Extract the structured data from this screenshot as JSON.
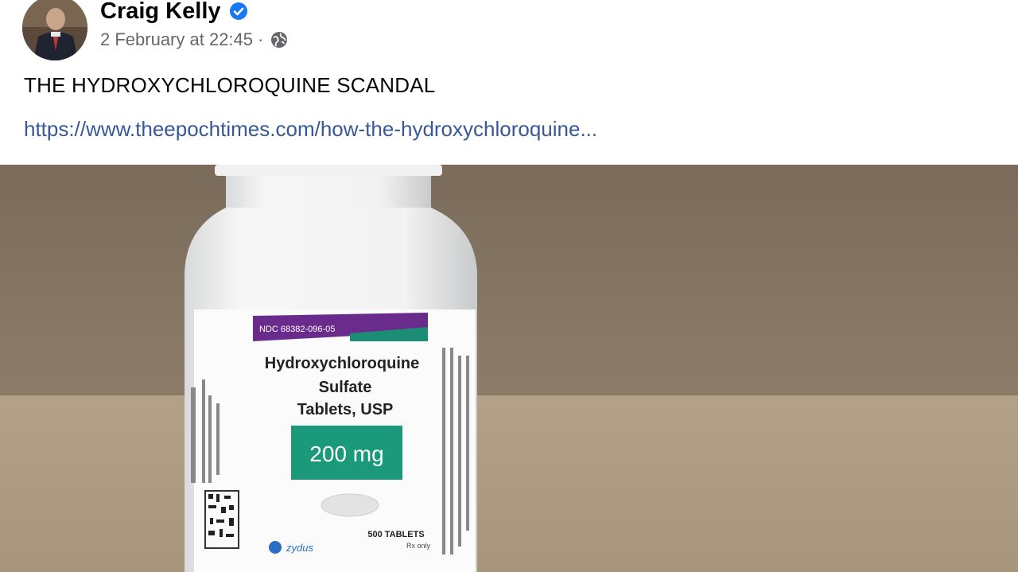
{
  "post": {
    "author": "Craig Kelly",
    "timestamp": "2 February at 22:45",
    "separator": "·",
    "text": "THE HYDROXYCHLOROQUINE SCANDAL",
    "link": "https://www.theepochtimes.com/how-the-hydroxychloroquine..."
  },
  "photo": {
    "label_ndc": "NDC 68382-096-05",
    "label_drug": "Hydroxychloroquine",
    "label_salt": "Sulfate",
    "label_form": "Tablets, USP",
    "label_dose": "200 mg",
    "label_count": "500 TABLETS",
    "label_rx": "Rx only",
    "label_brand": "zydus"
  },
  "colors": {
    "link": "#385898",
    "verified": "#1877f2",
    "dose_badge": "#1a9a7a",
    "ndc_band": "#6a2c8c",
    "teal_band": "#1d8c74"
  }
}
